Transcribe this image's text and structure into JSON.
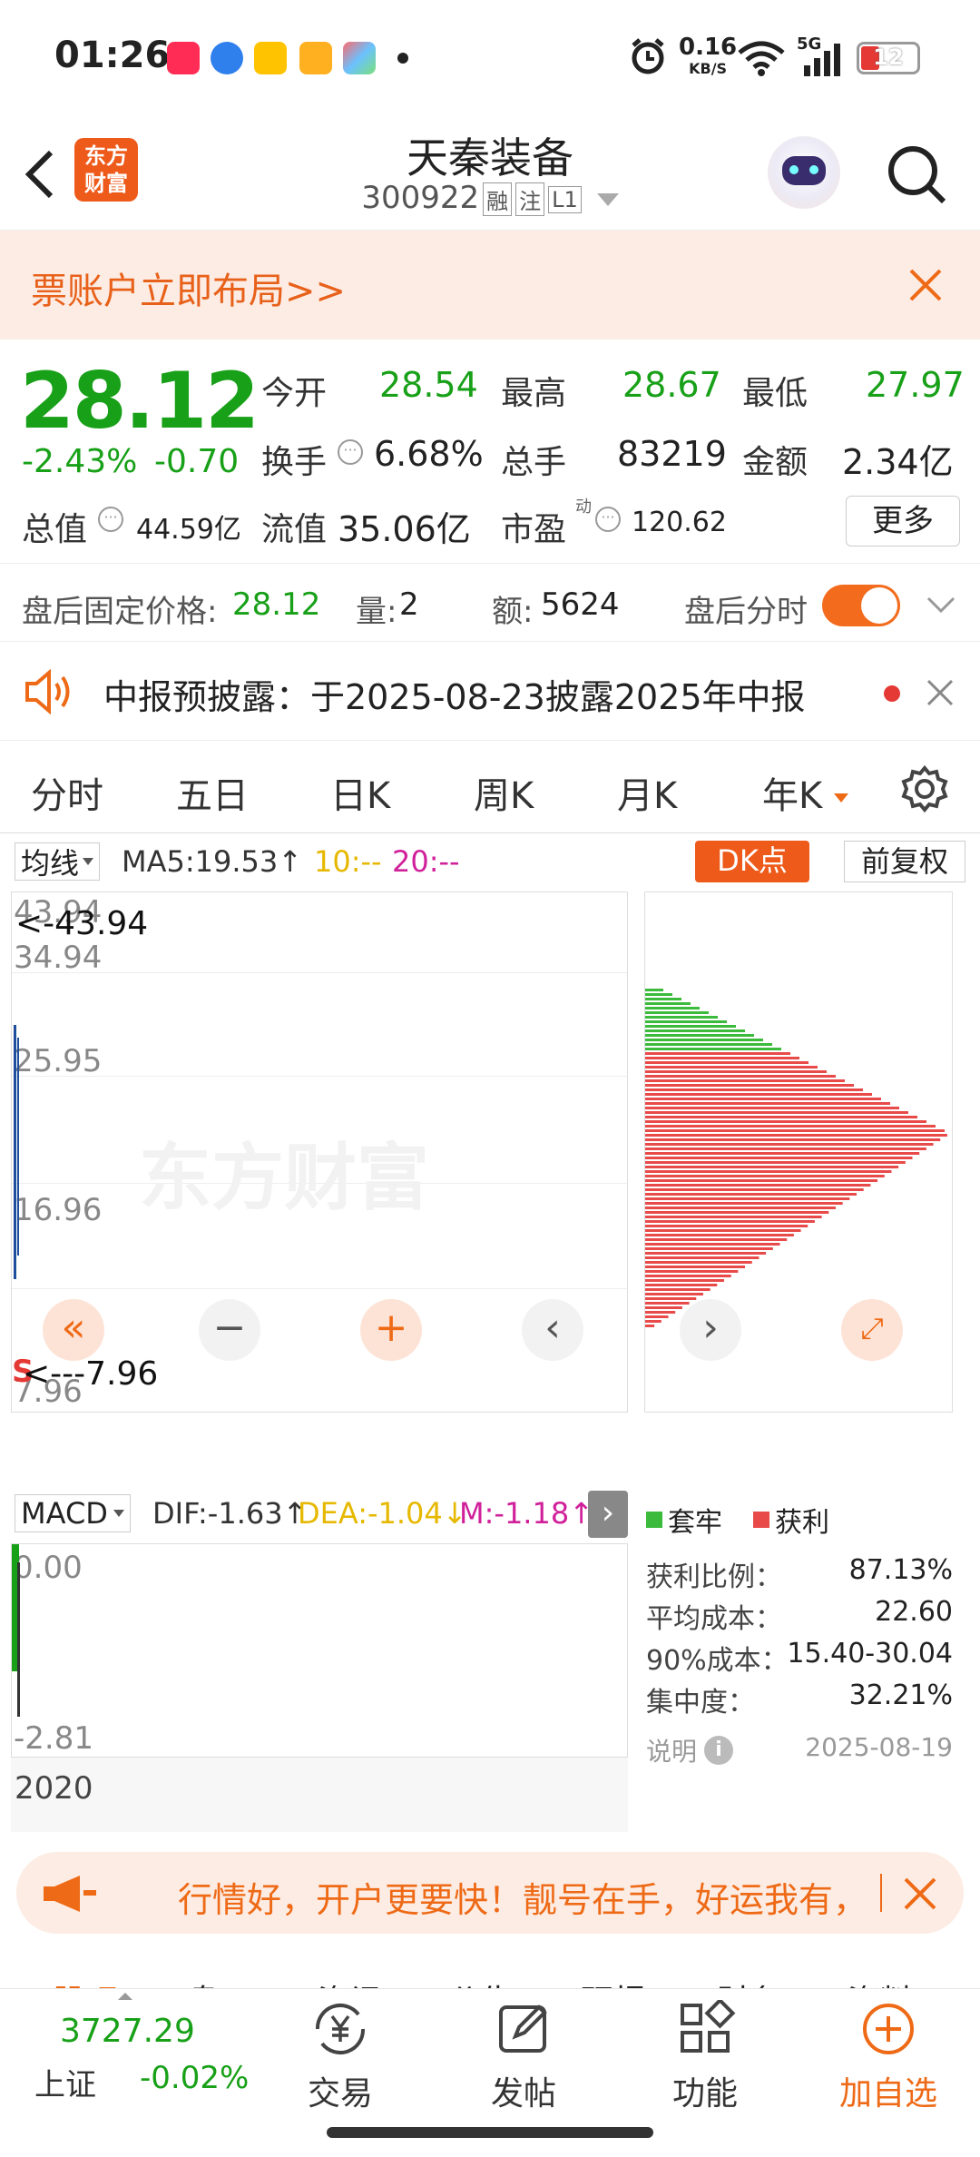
{
  "status_bar": {
    "time": "01:26",
    "speed_value": "0.16",
    "speed_unit": "KB/S",
    "network": "5G",
    "battery": "12",
    "app_icons": [
      "xiaohongshu-icon",
      "browser-icon",
      "meituan-icon",
      "video-icon",
      "app-icon"
    ]
  },
  "header": {
    "stock_name": "天秦装备",
    "stock_code": "300922",
    "tags": [
      "融",
      "注",
      "L1"
    ],
    "logo_line1": "东方",
    "logo_line2": "财富"
  },
  "banner": {
    "text": "票账户立即布局>>"
  },
  "quote": {
    "price": "28.12",
    "change_pct": "-2.43%",
    "change_amt": "-0.70",
    "open_label": "今开",
    "open_value": "28.54",
    "high_label": "最高",
    "high_value": "28.67",
    "low_label": "最低",
    "low_value": "27.97",
    "turnover_label": "换手",
    "turnover_value": "6.68%",
    "volume_label": "总手",
    "volume_value": "83219",
    "amount_label": "金额",
    "amount_value": "2.34亿",
    "mktcap_label": "总值",
    "mktcap_value": "44.59亿",
    "float_label": "流值",
    "float_value": "35.06亿",
    "pe_label": "市盈",
    "pe_sup": "动",
    "pe_value": "120.62",
    "more_button": "更多",
    "after_price_label": "盘后固定价格:",
    "after_price_value": "28.12",
    "after_vol_label": "量:",
    "after_vol_value": "2",
    "after_amt_label": "额:",
    "after_amt_value": "5624",
    "after_toggle_label": "盘后分时"
  },
  "notice": {
    "text": "中报预披露：于2025-08-23披露2025年中报"
  },
  "tabs": [
    "分时",
    "五日",
    "日K",
    "周K",
    "月K",
    "年K"
  ],
  "active_tab": "年K",
  "chart": {
    "ma_selector": "均线",
    "ma5": "MA5:19.53↑",
    "ma10": "10:--",
    "ma20": "20:--",
    "dk_button": "DK点",
    "adjust_button": "前复权",
    "max_marker": "<-43.94",
    "y_labels": [
      "43.94",
      "34.94",
      "25.95",
      "16.96",
      "7.96"
    ],
    "min_marker": "<---7.96",
    "s_marker": "S",
    "watermark": "东方财富",
    "macd_selector": "MACD",
    "dif": "DIF:-1.63↑",
    "dea": "DEA:-1.04↓",
    "m": "M:-1.18↑",
    "macd_labels": [
      "0.00",
      "-2.81"
    ],
    "x_label": "2020",
    "colors": {
      "ma5": "#333333",
      "ma10": "#e6b800",
      "ma20": "#d0209a",
      "up": "#e53935",
      "down": "#18a018"
    }
  },
  "chip": {
    "legend_loss": "套牢",
    "legend_profit": "获利",
    "profit_ratio_label": "获利比例：",
    "profit_ratio_value": "87.13%",
    "avg_cost_label": "平均成本：",
    "avg_cost_value": "22.60",
    "cost90_label": "90%成本：",
    "cost90_value": "15.40-30.04",
    "concentration_label": "集中度：",
    "concentration_value": "32.21%",
    "note_label": "说明",
    "date": "2025-08-19"
  },
  "promo": {
    "text": "行情好，开户更要快！靓号在手，好运我有，"
  },
  "bottom_nav": {
    "index_value": "3727.29",
    "index_name": "上证",
    "index_change": "-0.02%",
    "items": [
      "交易",
      "发帖",
      "功能",
      "加自选"
    ],
    "hidden_tabs": [
      "股吧",
      "盘口",
      "资讯",
      "公告",
      "研报",
      "财务",
      "资料"
    ]
  }
}
